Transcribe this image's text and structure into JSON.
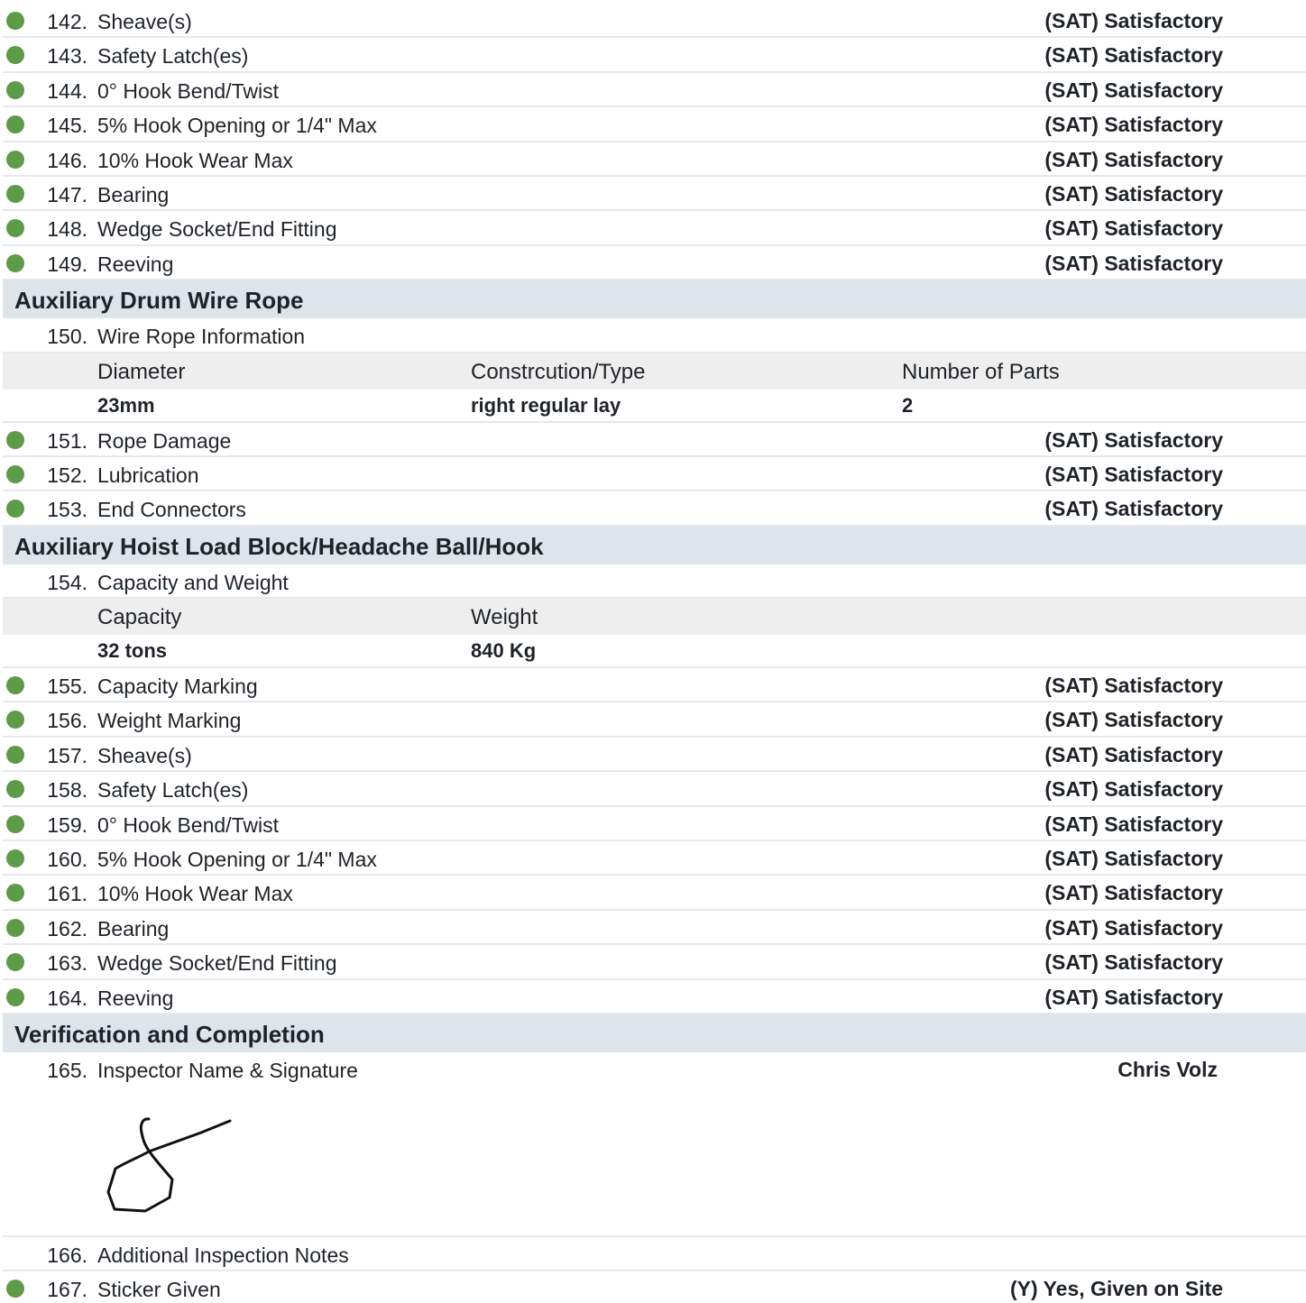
{
  "rows_a": [
    {
      "num": "142.",
      "label": "Sheave(s)",
      "value": "(SAT) Satisfactory"
    },
    {
      "num": "143.",
      "label": "Safety Latch(es)",
      "value": "(SAT) Satisfactory"
    },
    {
      "num": "144.",
      "label": "0° Hook Bend/Twist",
      "value": "(SAT) Satisfactory"
    },
    {
      "num": "145.",
      "label": "5% Hook Opening or 1/4\" Max",
      "value": "(SAT) Satisfactory"
    },
    {
      "num": "146.",
      "label": "10% Hook Wear Max",
      "value": "(SAT) Satisfactory"
    },
    {
      "num": "147.",
      "label": "Bearing",
      "value": "(SAT) Satisfactory"
    },
    {
      "num": "148.",
      "label": "Wedge Socket/End Fitting",
      "value": "(SAT) Satisfactory"
    },
    {
      "num": "149.",
      "label": "Reeving",
      "value": "(SAT) Satisfactory"
    }
  ],
  "section_wire_rope": {
    "title": "Auxiliary Drum Wire Rope",
    "info_num": "150.",
    "info_label": "Wire Rope Information",
    "headers": [
      "Diameter",
      "Constrcution/Type",
      "Number of Parts"
    ],
    "values": [
      "23mm",
      "right regular lay",
      "2"
    ],
    "rows": [
      {
        "num": "151.",
        "label": "Rope Damage",
        "value": "(SAT) Satisfactory"
      },
      {
        "num": "152.",
        "label": "Lubrication",
        "value": "(SAT) Satisfactory"
      },
      {
        "num": "153.",
        "label": "End Connectors",
        "value": "(SAT) Satisfactory"
      }
    ]
  },
  "section_hoist": {
    "title": "Auxiliary Hoist Load Block/Headache Ball/Hook",
    "info_num": "154.",
    "info_label": "Capacity and Weight",
    "headers": [
      "Capacity",
      "Weight"
    ],
    "values": [
      "32 tons",
      "840 Kg"
    ],
    "rows": [
      {
        "num": "155.",
        "label": "Capacity Marking",
        "value": "(SAT) Satisfactory"
      },
      {
        "num": "156.",
        "label": "Weight Marking",
        "value": "(SAT) Satisfactory"
      },
      {
        "num": "157.",
        "label": "Sheave(s)",
        "value": "(SAT) Satisfactory"
      },
      {
        "num": "158.",
        "label": "Safety Latch(es)",
        "value": "(SAT) Satisfactory"
      },
      {
        "num": "159.",
        "label": "0° Hook Bend/Twist",
        "value": "(SAT) Satisfactory"
      },
      {
        "num": "160.",
        "label": "5% Hook Opening or 1/4\" Max",
        "value": "(SAT) Satisfactory"
      },
      {
        "num": "161.",
        "label": "10% Hook Wear Max",
        "value": "(SAT) Satisfactory"
      },
      {
        "num": "162.",
        "label": "Bearing",
        "value": "(SAT) Satisfactory"
      },
      {
        "num": "163.",
        "label": "Wedge Socket/End Fitting",
        "value": "(SAT) Satisfactory"
      },
      {
        "num": "164.",
        "label": "Reeving",
        "value": "(SAT) Satisfactory"
      }
    ]
  },
  "section_verification": {
    "title": "Verification and Completion",
    "inspector_num": "165.",
    "inspector_label": "Inspector Name & Signature",
    "inspector_name": "Chris Volz",
    "notes_num": "166.",
    "notes_label": "Additional Inspection Notes",
    "sticker_num": "167.",
    "sticker_label": "Sticker Given",
    "sticker_value": "(Y) Yes, Given on Site"
  },
  "colors": {
    "status_dot": "#5d9b48",
    "section_bg": "#dde4ea",
    "subheader_bg": "#eeeeee"
  }
}
